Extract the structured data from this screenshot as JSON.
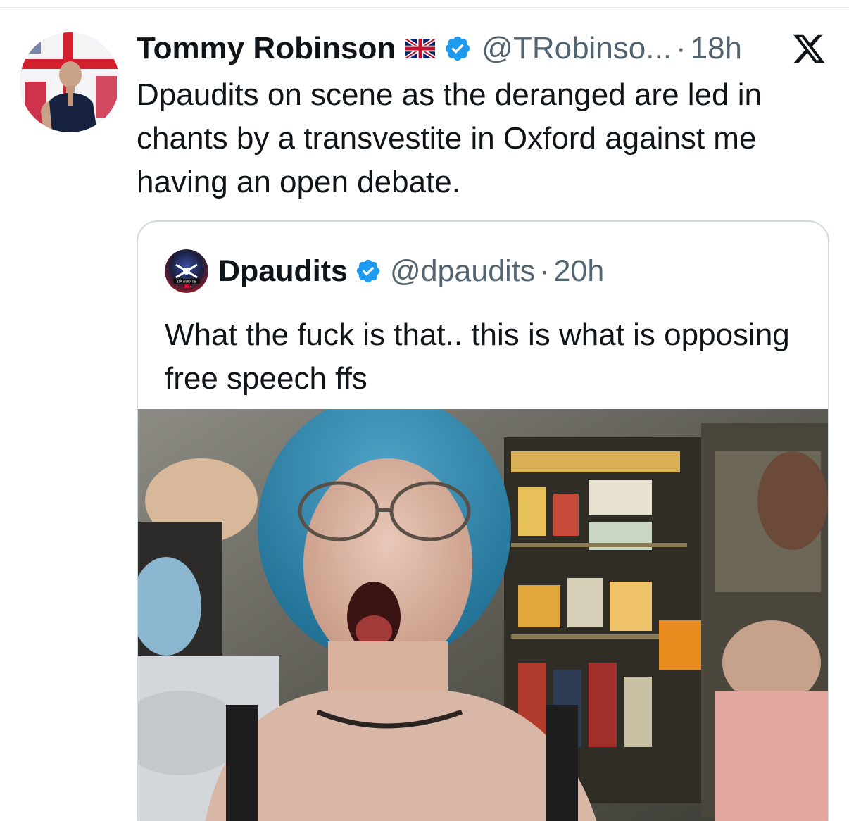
{
  "tweet": {
    "display_name": "Tommy Robinson",
    "handle": "@TRobinso...",
    "separator": "·",
    "time": "18h",
    "text": "Dpaudits on scene as the deranged are led in chants by a transvestite in Oxford against me having an open debate.",
    "icons": {
      "avatar": "profile-photo",
      "flag": "uk-flag-icon",
      "verified": "verified-badge-icon",
      "platform": "x-logo-icon"
    }
  },
  "quoted": {
    "display_name": "Dpaudits",
    "handle": "@dpaudits",
    "separator": "·",
    "time": "20h",
    "text": "What the fuck is that.. this is what is opposing free speech ffs",
    "avatar_logo_text": "DP AUDITS",
    "media": "video-thumbnail"
  },
  "colors": {
    "text_primary": "#0f1419",
    "text_secondary": "#536471",
    "verified_blue": "#1d9bf0",
    "border": "#cfd9de"
  }
}
